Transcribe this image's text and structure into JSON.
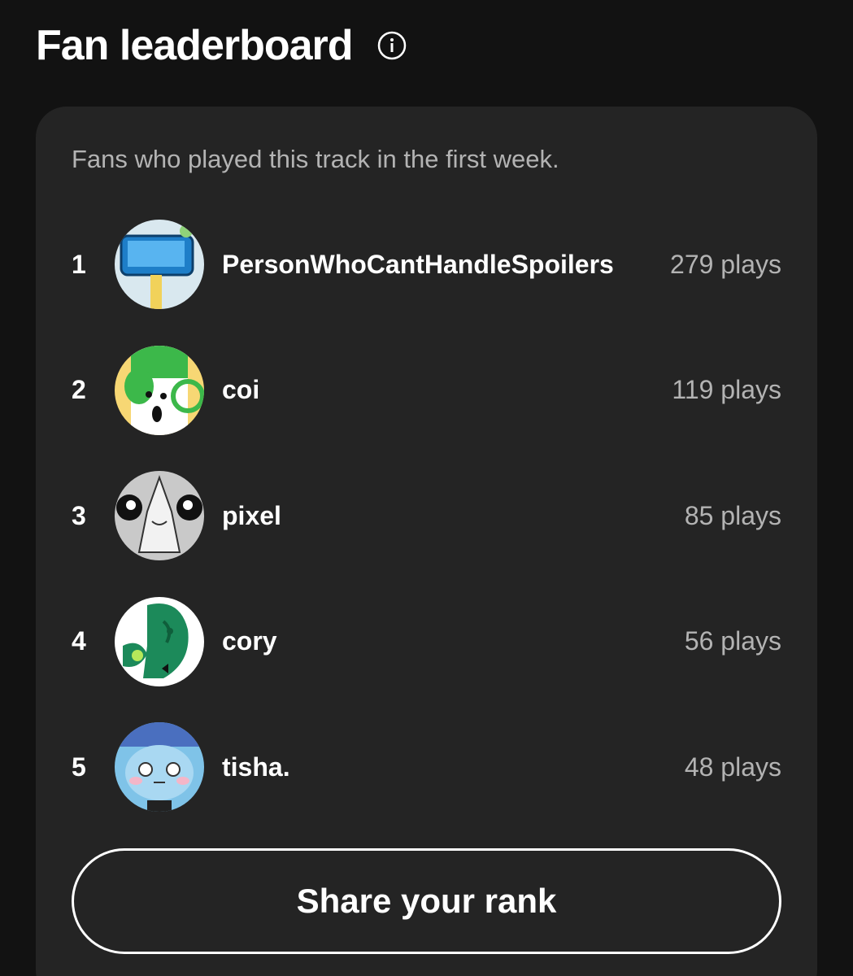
{
  "header": {
    "title": "Fan leaderboard",
    "info_icon": "info-circle-icon"
  },
  "card": {
    "subtitle": "Fans who played this track in the first week.",
    "fans": [
      {
        "rank": "1",
        "name": "PersonWhoCantHandleSpoilers",
        "plays": "279 plays",
        "avatar_colors": [
          "#d9e8ef",
          "#1e7ec8",
          "#f1d25a"
        ]
      },
      {
        "rank": "2",
        "name": "coi",
        "plays": "119 plays",
        "avatar_colors": [
          "#f7d774",
          "#3cb84a",
          "#ffffff"
        ]
      },
      {
        "rank": "3",
        "name": "pixel",
        "plays": "85 plays",
        "avatar_colors": [
          "#c9c9c9",
          "#111111",
          "#ffffff"
        ]
      },
      {
        "rank": "4",
        "name": "cory",
        "plays": "56 plays",
        "avatar_colors": [
          "#ffffff",
          "#1c8a5a",
          "#0f5e3b"
        ]
      },
      {
        "rank": "5",
        "name": "tisha.",
        "plays": "48 plays",
        "avatar_colors": [
          "#a9d8f2",
          "#7fc3e8",
          "#f4b6c8"
        ]
      }
    ],
    "share_label": "Share your rank"
  },
  "colors": {
    "background": "#121212",
    "card": "#242424",
    "muted_text": "#b3b3b3",
    "text": "#ffffff"
  }
}
